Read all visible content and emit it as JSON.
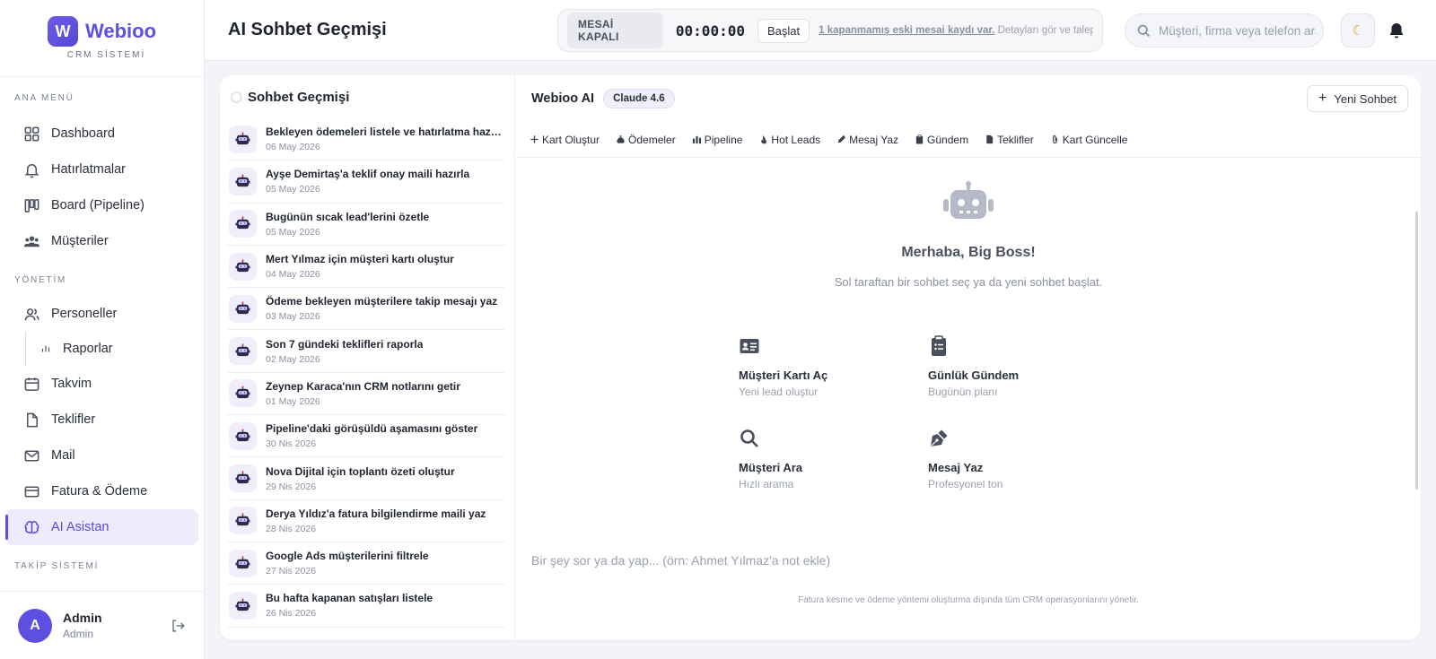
{
  "brand": {
    "logo_letter": "W",
    "name": "Webioo",
    "subtitle": "CRM SİSTEMİ"
  },
  "sidebar": {
    "section_main": "ANA MENÜ",
    "section_manage": "YÖNETİM",
    "section_tracking": "TAKİP SİSTEMİ",
    "items": [
      {
        "label": "Dashboard",
        "icon": "grid-icon"
      },
      {
        "label": "Hatırlatmalar",
        "icon": "bell-icon"
      },
      {
        "label": "Board (Pipeline)",
        "icon": "board-icon"
      },
      {
        "label": "Müşteriler",
        "icon": "users-icon"
      },
      {
        "label": "Personeller",
        "icon": "user-group-icon"
      },
      {
        "label": "Raporlar",
        "icon": "bar-chart-icon"
      },
      {
        "label": "Takvim",
        "icon": "calendar-icon"
      },
      {
        "label": "Teklifler",
        "icon": "document-icon"
      },
      {
        "label": "Mail",
        "icon": "mail-icon"
      },
      {
        "label": "Fatura & Ödeme",
        "icon": "credit-card-icon"
      },
      {
        "label": "AI Asistan",
        "icon": "brain-icon",
        "active": true
      }
    ]
  },
  "user": {
    "initial": "A",
    "name": "Admin",
    "role": "Admin"
  },
  "header": {
    "title": "AI Sohbet Geçmişi",
    "shift_status": "MESAİ KAPALI",
    "timer": "00:00:00",
    "start_label": "Başlat",
    "shift_link": "1 kapanmamış eski mesai kaydı var.",
    "shift_note": " Detayları gör ve talep gir.",
    "search_placeholder": "Müşteri, firma veya telefon ara...",
    "theme_icon": "☾"
  },
  "history": {
    "title": "Sohbet Geçmişi",
    "items": [
      {
        "title": "Bekleyen ödemeleri listele ve hatırlatma hazırla",
        "date": "06 May 2026"
      },
      {
        "title": "Ayşe Demirtaş'a teklif onay maili hazırla",
        "date": "05 May 2026"
      },
      {
        "title": "Bugünün sıcak lead'lerini özetle",
        "date": "05 May 2026"
      },
      {
        "title": "Mert Yılmaz için müşteri kartı oluştur",
        "date": "04 May 2026"
      },
      {
        "title": "Ödeme bekleyen müşterilere takip mesajı yaz",
        "date": "03 May 2026"
      },
      {
        "title": "Son 7 gündeki teklifleri raporla",
        "date": "02 May 2026"
      },
      {
        "title": "Zeynep Karaca'nın CRM notlarını getir",
        "date": "01 May 2026"
      },
      {
        "title": "Pipeline'daki görüşüldü aşamasını göster",
        "date": "30 Nis 2026"
      },
      {
        "title": "Nova Dijital için toplantı özeti oluştur",
        "date": "29 Nis 2026"
      },
      {
        "title": "Derya Yıldız'a fatura bilgilendirme maili yaz",
        "date": "28 Nis 2026"
      },
      {
        "title": "Google Ads müşterilerini filtrele",
        "date": "27 Nis 2026"
      },
      {
        "title": "Bu hafta kapanan satışları listele",
        "date": "26 Nis 2026"
      }
    ]
  },
  "chat": {
    "assistant_name": "Webioo AI",
    "model": "Claude 4.6",
    "new_chat_label": "Yeni Sohbet",
    "quick_actions": [
      {
        "label": "Kart Oluştur",
        "icon": "plus-icon"
      },
      {
        "label": "Ödemeler",
        "icon": "money-bag-icon"
      },
      {
        "label": "Pipeline",
        "icon": "bar-chart-icon"
      },
      {
        "label": "Hot Leads",
        "icon": "fire-icon"
      },
      {
        "label": "Mesaj Yaz",
        "icon": "pen-icon"
      },
      {
        "label": "Gündem",
        "icon": "clipboard-icon"
      },
      {
        "label": "Teklifler",
        "icon": "document-icon"
      },
      {
        "label": "Kart Güncelle",
        "icon": "paperclip-icon"
      }
    ],
    "greeting": "Merhaba, Big Boss!",
    "greeting_sub": "Sol taraftan bir sohbet seç ya da yeni sohbet başlat.",
    "cards": [
      {
        "title": "Müşteri Kartı Aç",
        "subtitle": "Yeni lead oluştur",
        "icon": "id-card-icon"
      },
      {
        "title": "Günlük Gündem",
        "subtitle": "Bugünün planı",
        "icon": "clipboard-icon"
      },
      {
        "title": "Müşteri Ara",
        "subtitle": "Hızlı arama",
        "icon": "search-icon"
      },
      {
        "title": "Mesaj Yaz",
        "subtitle": "Profesyonel ton",
        "icon": "pen-nib-icon"
      }
    ],
    "input_placeholder": "Bir şey sor ya da yap... (örn: Ahmet Yılmaz'a not ekle)",
    "footer_note": "Fatura kesme ve ödeme yöntemi oluşturma dışında tüm CRM operasyonlarını yönetir."
  },
  "colors": {
    "accent": "#5d4fe0",
    "accent_soft": "#eeecfc",
    "text": "#1f2430",
    "muted": "#8a90a0"
  }
}
